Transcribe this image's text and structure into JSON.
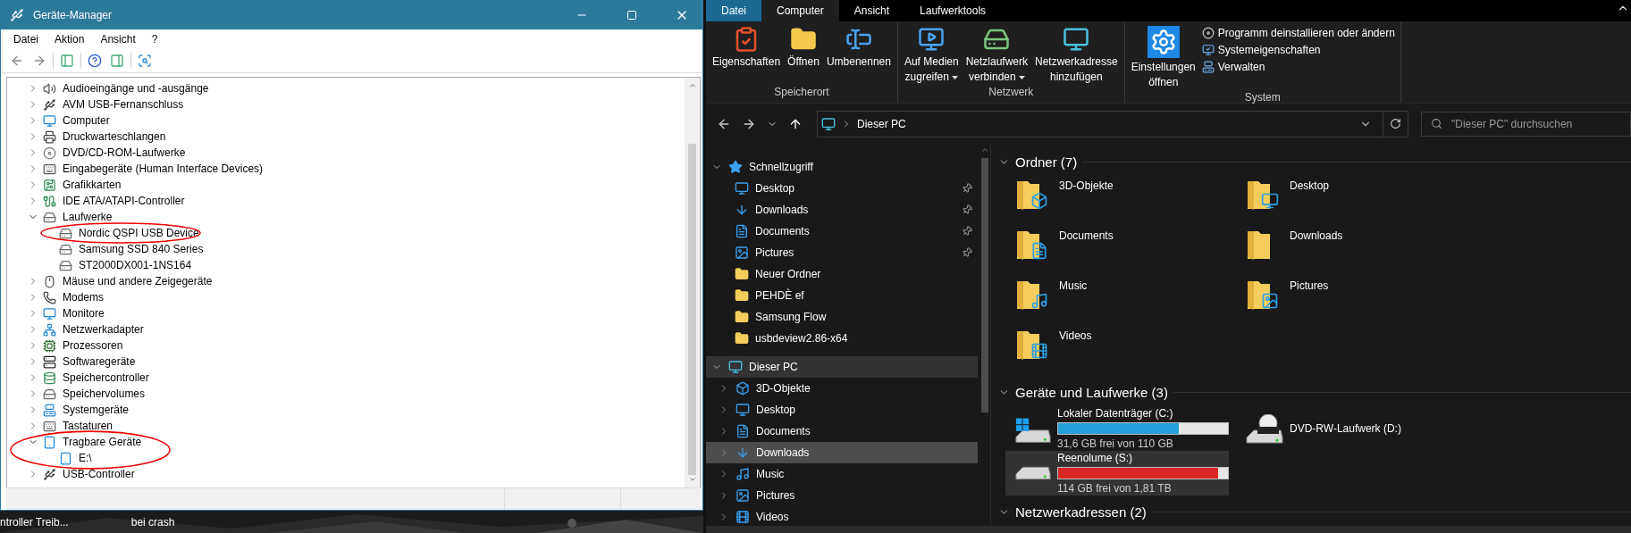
{
  "device_manager": {
    "title": "Geräte-Manager",
    "menu": [
      "Datei",
      "Aktion",
      "Ansicht",
      "?"
    ],
    "tree": [
      {
        "label": "Audioeingänge und -ausgänge",
        "expanded": false,
        "circled": false
      },
      {
        "label": "AVM USB-Fernanschluss",
        "expanded": false,
        "circled": false
      },
      {
        "label": "Computer",
        "expanded": false,
        "circled": false
      },
      {
        "label": "Druckwarteschlangen",
        "expanded": false,
        "circled": false
      },
      {
        "label": "DVD/CD-ROM-Laufwerke",
        "expanded": false,
        "circled": false
      },
      {
        "label": "Eingabegeräte (Human Interface Devices)",
        "expanded": false,
        "circled": false
      },
      {
        "label": "Grafikkarten",
        "expanded": false,
        "circled": false
      },
      {
        "label": "IDE ATA/ATAPI-Controller",
        "expanded": false,
        "circled": false
      },
      {
        "label": "Laufwerke",
        "expanded": true,
        "circled": false,
        "children": [
          {
            "label": "Nordic QSPI USB Device",
            "circled": true
          },
          {
            "label": "Samsung SSD 840 Series",
            "circled": false
          },
          {
            "label": "ST2000DX001-1NS164",
            "circled": false
          }
        ]
      },
      {
        "label": "Mäuse und andere Zeigegeräte",
        "expanded": false,
        "circled": false
      },
      {
        "label": "Modems",
        "expanded": false,
        "circled": false
      },
      {
        "label": "Monitore",
        "expanded": false,
        "circled": false
      },
      {
        "label": "Netzwerkadapter",
        "expanded": false,
        "circled": false
      },
      {
        "label": "Prozessoren",
        "expanded": false,
        "circled": false
      },
      {
        "label": "Softwaregeräte",
        "expanded": false,
        "circled": false
      },
      {
        "label": "Speichercontroller",
        "expanded": false,
        "circled": false
      },
      {
        "label": "Speichervolumes",
        "expanded": false,
        "circled": false
      },
      {
        "label": "Systemgeräte",
        "expanded": false,
        "circled": false
      },
      {
        "label": "Tastaturen",
        "expanded": false,
        "circled": false
      },
      {
        "label": "Tragbare Geräte",
        "expanded": true,
        "circled": true,
        "children": [
          {
            "label": "E:\\",
            "circled": false
          }
        ]
      },
      {
        "label": "USB-Controller",
        "expanded": false,
        "circled": false
      }
    ]
  },
  "desktop": {
    "labels": [
      "ntroller Treib...",
      "bei crash"
    ]
  },
  "explorer": {
    "tabs": [
      {
        "label": "Datei",
        "kind": "file",
        "selected": false
      },
      {
        "label": "Computer",
        "kind": "tab",
        "selected": true
      },
      {
        "label": "Ansicht",
        "kind": "tab",
        "selected": false
      },
      {
        "label": "Laufwerktools",
        "kind": "tab",
        "selected": false
      }
    ],
    "ribbon_groups": [
      {
        "label": "Speicherort",
        "buttons": [
          {
            "kind": "large",
            "lines": [
              "Eigenschaften"
            ],
            "dropdown": false
          },
          {
            "kind": "large",
            "lines": [
              "Öffnen"
            ],
            "dropdown": false
          },
          {
            "kind": "large",
            "lines": [
              "Umbenennen"
            ],
            "dropdown": false
          }
        ]
      },
      {
        "label": "Netzwerk",
        "buttons": [
          {
            "kind": "large",
            "lines": [
              "Auf Medien",
              "zugreifen"
            ],
            "dropdown": true
          },
          {
            "kind": "large",
            "lines": [
              "Netzlaufwerk",
              "verbinden"
            ],
            "dropdown": true
          },
          {
            "kind": "large",
            "lines": [
              "Netzwerkadresse",
              "hinzufügen"
            ],
            "dropdown": false
          }
        ]
      },
      {
        "label": "System",
        "buttons": [
          {
            "kind": "large",
            "lines": [
              "Einstellungen",
              "öffnen"
            ],
            "dropdown": false
          },
          {
            "kind": "small",
            "lines": [
              "Programm deinstallieren oder ändern"
            ],
            "dropdown": false
          },
          {
            "kind": "small",
            "lines": [
              "Systemeigenschaften"
            ],
            "dropdown": false
          },
          {
            "kind": "small",
            "lines": [
              "Verwalten"
            ],
            "dropdown": false
          }
        ]
      }
    ],
    "address": {
      "path": "Dieser PC"
    },
    "search": {
      "placeholder": "\"Dieser PC\" durchsuchen"
    },
    "nav": [
      {
        "label": "Schnellzugriff",
        "expanded": true,
        "selected": false,
        "hovered": false,
        "children": [
          {
            "label": "Desktop",
            "pinned": true,
            "selected": false,
            "hovered": false
          },
          {
            "label": "Downloads",
            "pinned": true,
            "selected": false,
            "hovered": false
          },
          {
            "label": "Documents",
            "pinned": true,
            "selected": false,
            "hovered": false
          },
          {
            "label": "Pictures",
            "pinned": true,
            "selected": false,
            "hovered": false
          },
          {
            "label": "Neuer Ordner",
            "pinned": false,
            "selected": false,
            "hovered": false
          },
          {
            "label": "PEHDÈ ef",
            "pinned": false,
            "selected": false,
            "hovered": false
          },
          {
            "label": "Samsung Flow",
            "pinned": false,
            "selected": false,
            "hovered": false
          },
          {
            "label": "usbdeview2.86-x64",
            "pinned": false,
            "selected": false,
            "hovered": false
          }
        ]
      },
      {
        "label": "Dieser PC",
        "expanded": true,
        "selected": false,
        "hovered": true,
        "children": [
          {
            "label": "3D-Objekte",
            "expanded": false,
            "selected": false,
            "hovered": false
          },
          {
            "label": "Desktop",
            "expanded": false,
            "selected": false,
            "hovered": false
          },
          {
            "label": "Documents",
            "expanded": false,
            "selected": false,
            "hovered": false
          },
          {
            "label": "Downloads",
            "expanded": false,
            "selected": true,
            "hovered": false
          },
          {
            "label": "Music",
            "expanded": false,
            "selected": false,
            "hovered": false
          },
          {
            "label": "Pictures",
            "expanded": false,
            "selected": false,
            "hovered": false
          },
          {
            "label": "Videos",
            "expanded": false,
            "selected": false,
            "hovered": false
          }
        ]
      }
    ],
    "sections": [
      {
        "title": "Ordner (7)",
        "expanded": true,
        "folders": [
          {
            "label": "3D-Objekte"
          },
          {
            "label": "Desktop"
          },
          {
            "label": "Documents"
          },
          {
            "label": "Downloads"
          },
          {
            "label": "Music"
          },
          {
            "label": "Pictures"
          },
          {
            "label": "Videos"
          }
        ]
      },
      {
        "title": "Geräte und Laufwerke (3)",
        "expanded": true,
        "drives": [
          {
            "kind": "disk",
            "label": "Lokaler Datenträger (C:)",
            "level": 0.71,
            "free": "31,6 GB frei von 110 GB",
            "warning": false,
            "selected": false
          },
          {
            "kind": "optical",
            "label": "DVD-RW-Laufwerk (D:)",
            "selected": false
          },
          {
            "kind": "disk",
            "label": "Reenolume (S:)",
            "level": 0.94,
            "free": "114 GB frei von 1,81 TB",
            "warning": true,
            "selected": true
          }
        ]
      },
      {
        "title": "Netzwerkadressen (2)",
        "expanded": true
      }
    ]
  }
}
